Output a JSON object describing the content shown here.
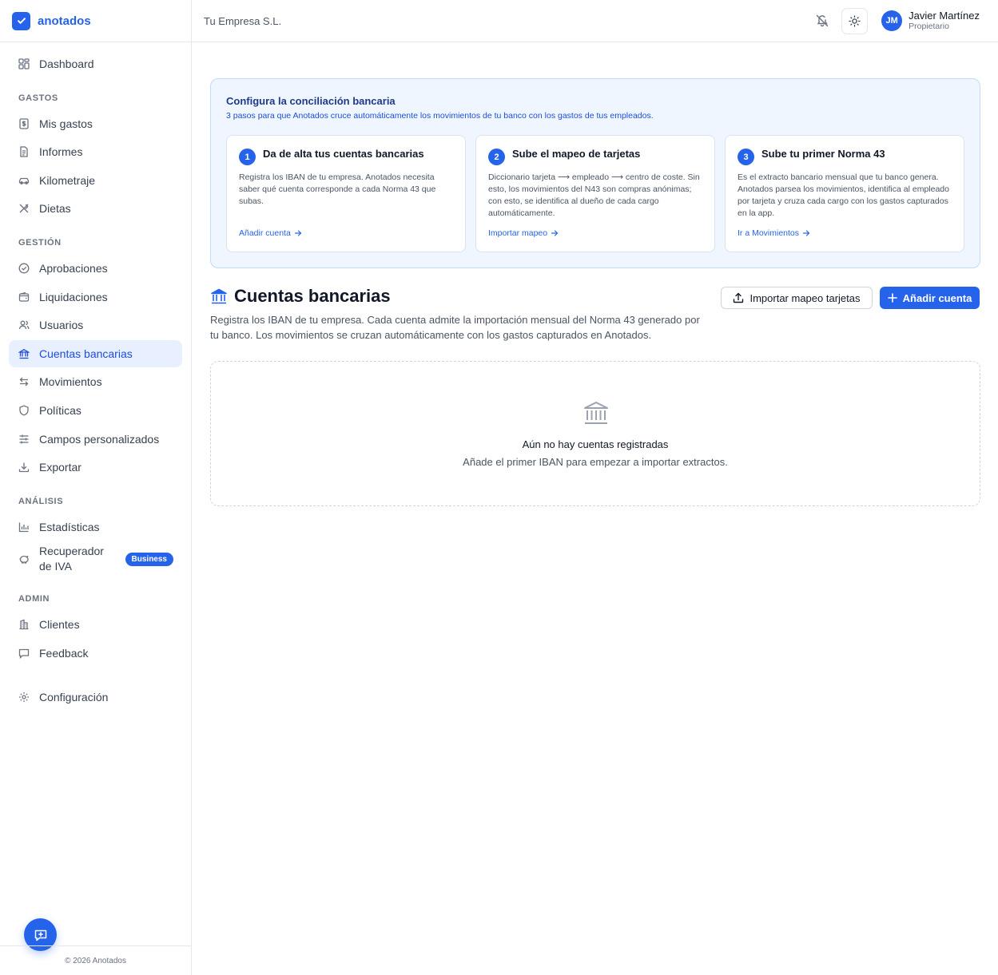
{
  "app": {
    "name": "anotados"
  },
  "header": {
    "company": "Tu Empresa S.L.",
    "user": {
      "initials": "JM",
      "name": "Javier Martínez",
      "role": "Propietario"
    }
  },
  "sidebar": {
    "dashboard": "Dashboard",
    "sections": {
      "gastos": "GASTOS",
      "gestion": "GESTIÓN",
      "analisis": "ANÁLISIS",
      "admin": "ADMIN"
    },
    "items": {
      "mis_gastos": "Mis gastos",
      "informes": "Informes",
      "kilometraje": "Kilometraje",
      "dietas": "Dietas",
      "aprobaciones": "Aprobaciones",
      "liquidaciones": "Liquidaciones",
      "usuarios": "Usuarios",
      "cuentas_bancarias": "Cuentas bancarias",
      "movimientos": "Movimientos",
      "politicas": "Políticas",
      "campos": "Campos personalizados",
      "exportar": "Exportar",
      "estadisticas": "Estadísticas",
      "recuperador": "Recuperador de IVA",
      "recuperador_badge": "Business",
      "clientes": "Clientes",
      "feedback": "Feedback",
      "configuracion": "Configuración"
    },
    "copyright": "© 2026 Anotados"
  },
  "setup": {
    "title": "Configura la conciliación bancaria",
    "subtitle": "3 pasos para que Anotados cruce automáticamente los movimientos de tu banco con los gastos de tus empleados.",
    "steps": [
      {
        "num": "1",
        "title": "Da de alta tus cuentas bancarias",
        "desc": "Registra los IBAN de tu empresa. Anotados necesita saber qué cuenta corresponde a cada Norma 43 que subas.",
        "link": "Añadir cuenta"
      },
      {
        "num": "2",
        "title": "Sube el mapeo de tarjetas",
        "desc": "Diccionario tarjeta ⟶ empleado ⟶ centro de coste. Sin esto, los movimientos del N43 son compras anónimas; con esto, se identifica al dueño de cada cargo automáticamente.",
        "link": "Importar mapeo"
      },
      {
        "num": "3",
        "title": "Sube tu primer Norma 43",
        "desc": "Es el extracto bancario mensual que tu banco genera. Anotados parsea los movimientos, identifica al empleado por tarjeta y cruza cada cargo con los gastos capturados en la app.",
        "link": "Ir a Movimientos"
      }
    ]
  },
  "page": {
    "title": "Cuentas bancarias",
    "description": "Registra los IBAN de tu empresa. Cada cuenta admite la importación mensual del Norma 43 generado por tu banco. Los movimientos se cruzan automáticamente con los gastos capturados en Anotados.",
    "import_button": "Importar mapeo tarjetas",
    "add_button": "Añadir cuenta",
    "empty_title": "Aún no hay cuentas registradas",
    "empty_subtitle": "Añade el primer IBAN para empezar a importar extractos."
  },
  "colors": {
    "accent": "#2563eb",
    "active_bg": "#e8efff",
    "setup_bg": "#eff6ff"
  }
}
